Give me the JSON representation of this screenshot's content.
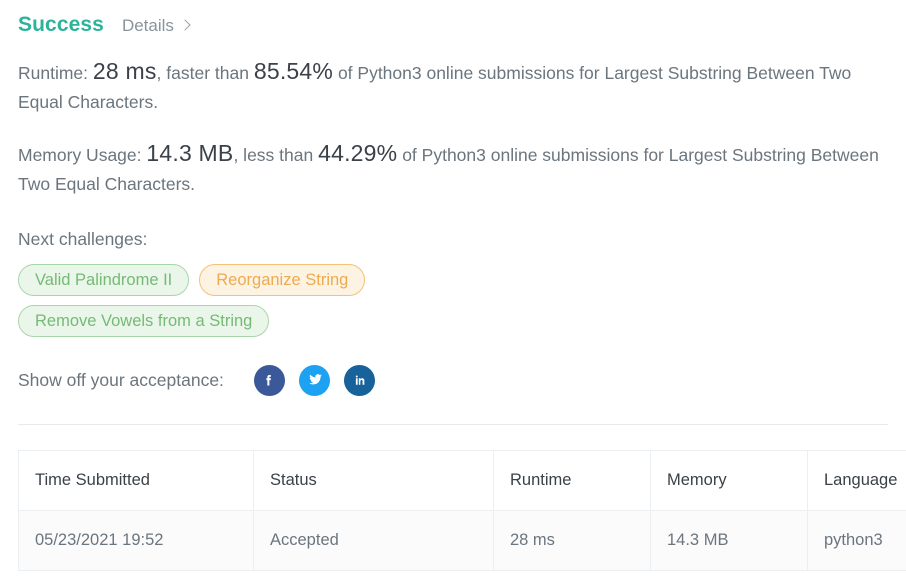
{
  "header": {
    "status": "Success",
    "details_label": "Details",
    "chevron_icon": "chevron-right-icon"
  },
  "stats": {
    "runtime": {
      "prefix": "Runtime:",
      "value": "28 ms",
      "mid": ", faster than",
      "percent": "85.54%",
      "suffix": "of Python3 online submissions for Largest Substring Between Two Equal Characters."
    },
    "memory": {
      "prefix": "Memory Usage:",
      "value": "14.3 MB",
      "mid": ", less than",
      "percent": "44.29%",
      "suffix": "of Python3 online submissions for Largest Substring Between Two Equal Characters."
    }
  },
  "challenges": {
    "label": "Next challenges:",
    "tags": [
      {
        "label": "Valid Palindrome II",
        "color": "green"
      },
      {
        "label": "Reorganize String",
        "color": "orange"
      },
      {
        "label": "Remove Vowels from a String",
        "color": "green"
      }
    ]
  },
  "share": {
    "label": "Show off your acceptance:",
    "networks": [
      {
        "name": "facebook-icon",
        "color": "#3b5998"
      },
      {
        "name": "twitter-icon",
        "color": "#1da1f2"
      },
      {
        "name": "linkedin-icon",
        "color": "#17629b"
      }
    ]
  },
  "table": {
    "columns": [
      "Time Submitted",
      "Status",
      "Runtime",
      "Memory",
      "Language"
    ],
    "rows": [
      {
        "time_submitted": "05/23/2021 19:52",
        "status": "Accepted",
        "runtime": "28 ms",
        "memory": "14.3 MB",
        "language": "python3"
      }
    ]
  },
  "colors": {
    "success": "#2db39b",
    "accepted": "#2db39b",
    "tag_green_text": "#76ba76",
    "tag_green_border": "#a9d6a9",
    "tag_green_bg": "#eaf6ea",
    "tag_orange_text": "#eeaa4e",
    "tag_orange_border": "#f3c277",
    "tag_orange_bg": "#fdf3e3",
    "body_text": "#6b757e",
    "strong_text": "#3a4149"
  }
}
